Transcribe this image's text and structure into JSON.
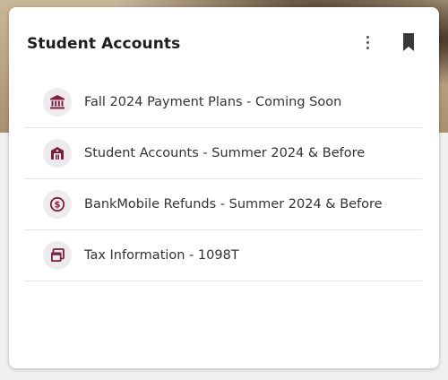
{
  "card": {
    "title": "Student Accounts",
    "menu_icon": "more-vert-icon",
    "bookmark_icon": "bookmark-icon"
  },
  "items": [
    {
      "label": "Fall 2024 Payment Plans - Coming Soon",
      "icon": "bank-icon"
    },
    {
      "label": "Student Accounts - Summer 2024 & Before",
      "icon": "building-icon"
    },
    {
      "label": "BankMobile Refunds - Summer 2024 & Before",
      "icon": "dollar-circle-icon"
    },
    {
      "label": "Tax Information - 1098T",
      "icon": "document-stack-icon"
    }
  ],
  "colors": {
    "icon_color": "#7a1f3d",
    "icon_bg": "#eeebee",
    "text": "#333333"
  }
}
